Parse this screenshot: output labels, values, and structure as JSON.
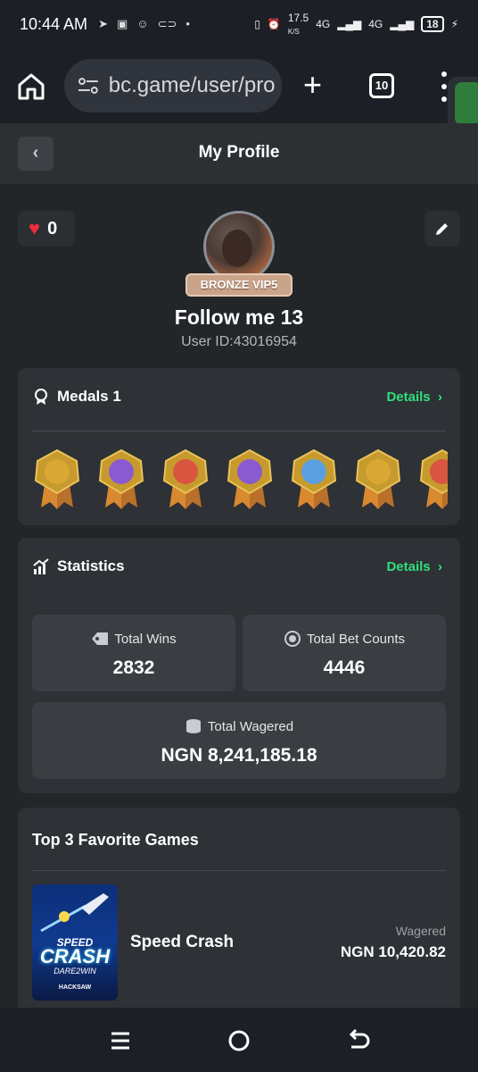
{
  "status_bar": {
    "time": "10:44 AM",
    "net_speed": "17.5",
    "net_unit": "K/S",
    "signal_1": "4G",
    "signal_2": "4G",
    "battery": "18"
  },
  "browser": {
    "url": "bc.game/user/pro",
    "tab_count": "10"
  },
  "header": {
    "title": "My Profile"
  },
  "profile": {
    "likes": "0",
    "vip_badge": "BRONZE VIP5",
    "username": "Follow me 13",
    "user_id": "User ID:43016954"
  },
  "medals": {
    "title": "Medals 1",
    "details_label": "Details",
    "items": [
      {
        "name": "medal-steering",
        "color": "#d9a834"
      },
      {
        "name": "medal-chat",
        "color": "#8a5ad0"
      },
      {
        "name": "medal-heart",
        "color": "#d9553f"
      },
      {
        "name": "medal-wallet",
        "color": "#8a5ad0"
      },
      {
        "name": "medal-thumbs-up",
        "color": "#5aa0e0"
      },
      {
        "name": "medal-coin",
        "color": "#d9a834"
      },
      {
        "name": "medal-char",
        "color": "#d9553f"
      }
    ]
  },
  "statistics": {
    "title": "Statistics",
    "details_label": "Details",
    "total_wins_label": "Total Wins",
    "total_wins": "2832",
    "total_bets_label": "Total Bet Counts",
    "total_bets": "4446",
    "total_wagered_label": "Total Wagered",
    "total_wagered": "NGN 8,241,185.18"
  },
  "favorites": {
    "title": "Top 3 Favorite Games",
    "games": [
      {
        "name": "Speed Crash",
        "thumb_line1": "SPEED",
        "thumb_line2": "CRASH",
        "thumb_line3": "DARE2WIN",
        "thumb_line4": "HACKSAW",
        "wager_label": "Wagered",
        "wager_value": "NGN 10,420.82"
      }
    ]
  },
  "colors": {
    "accent_green": "#2fe07c",
    "heart_red": "#ec2d3c",
    "card_bg": "#2e3135"
  }
}
